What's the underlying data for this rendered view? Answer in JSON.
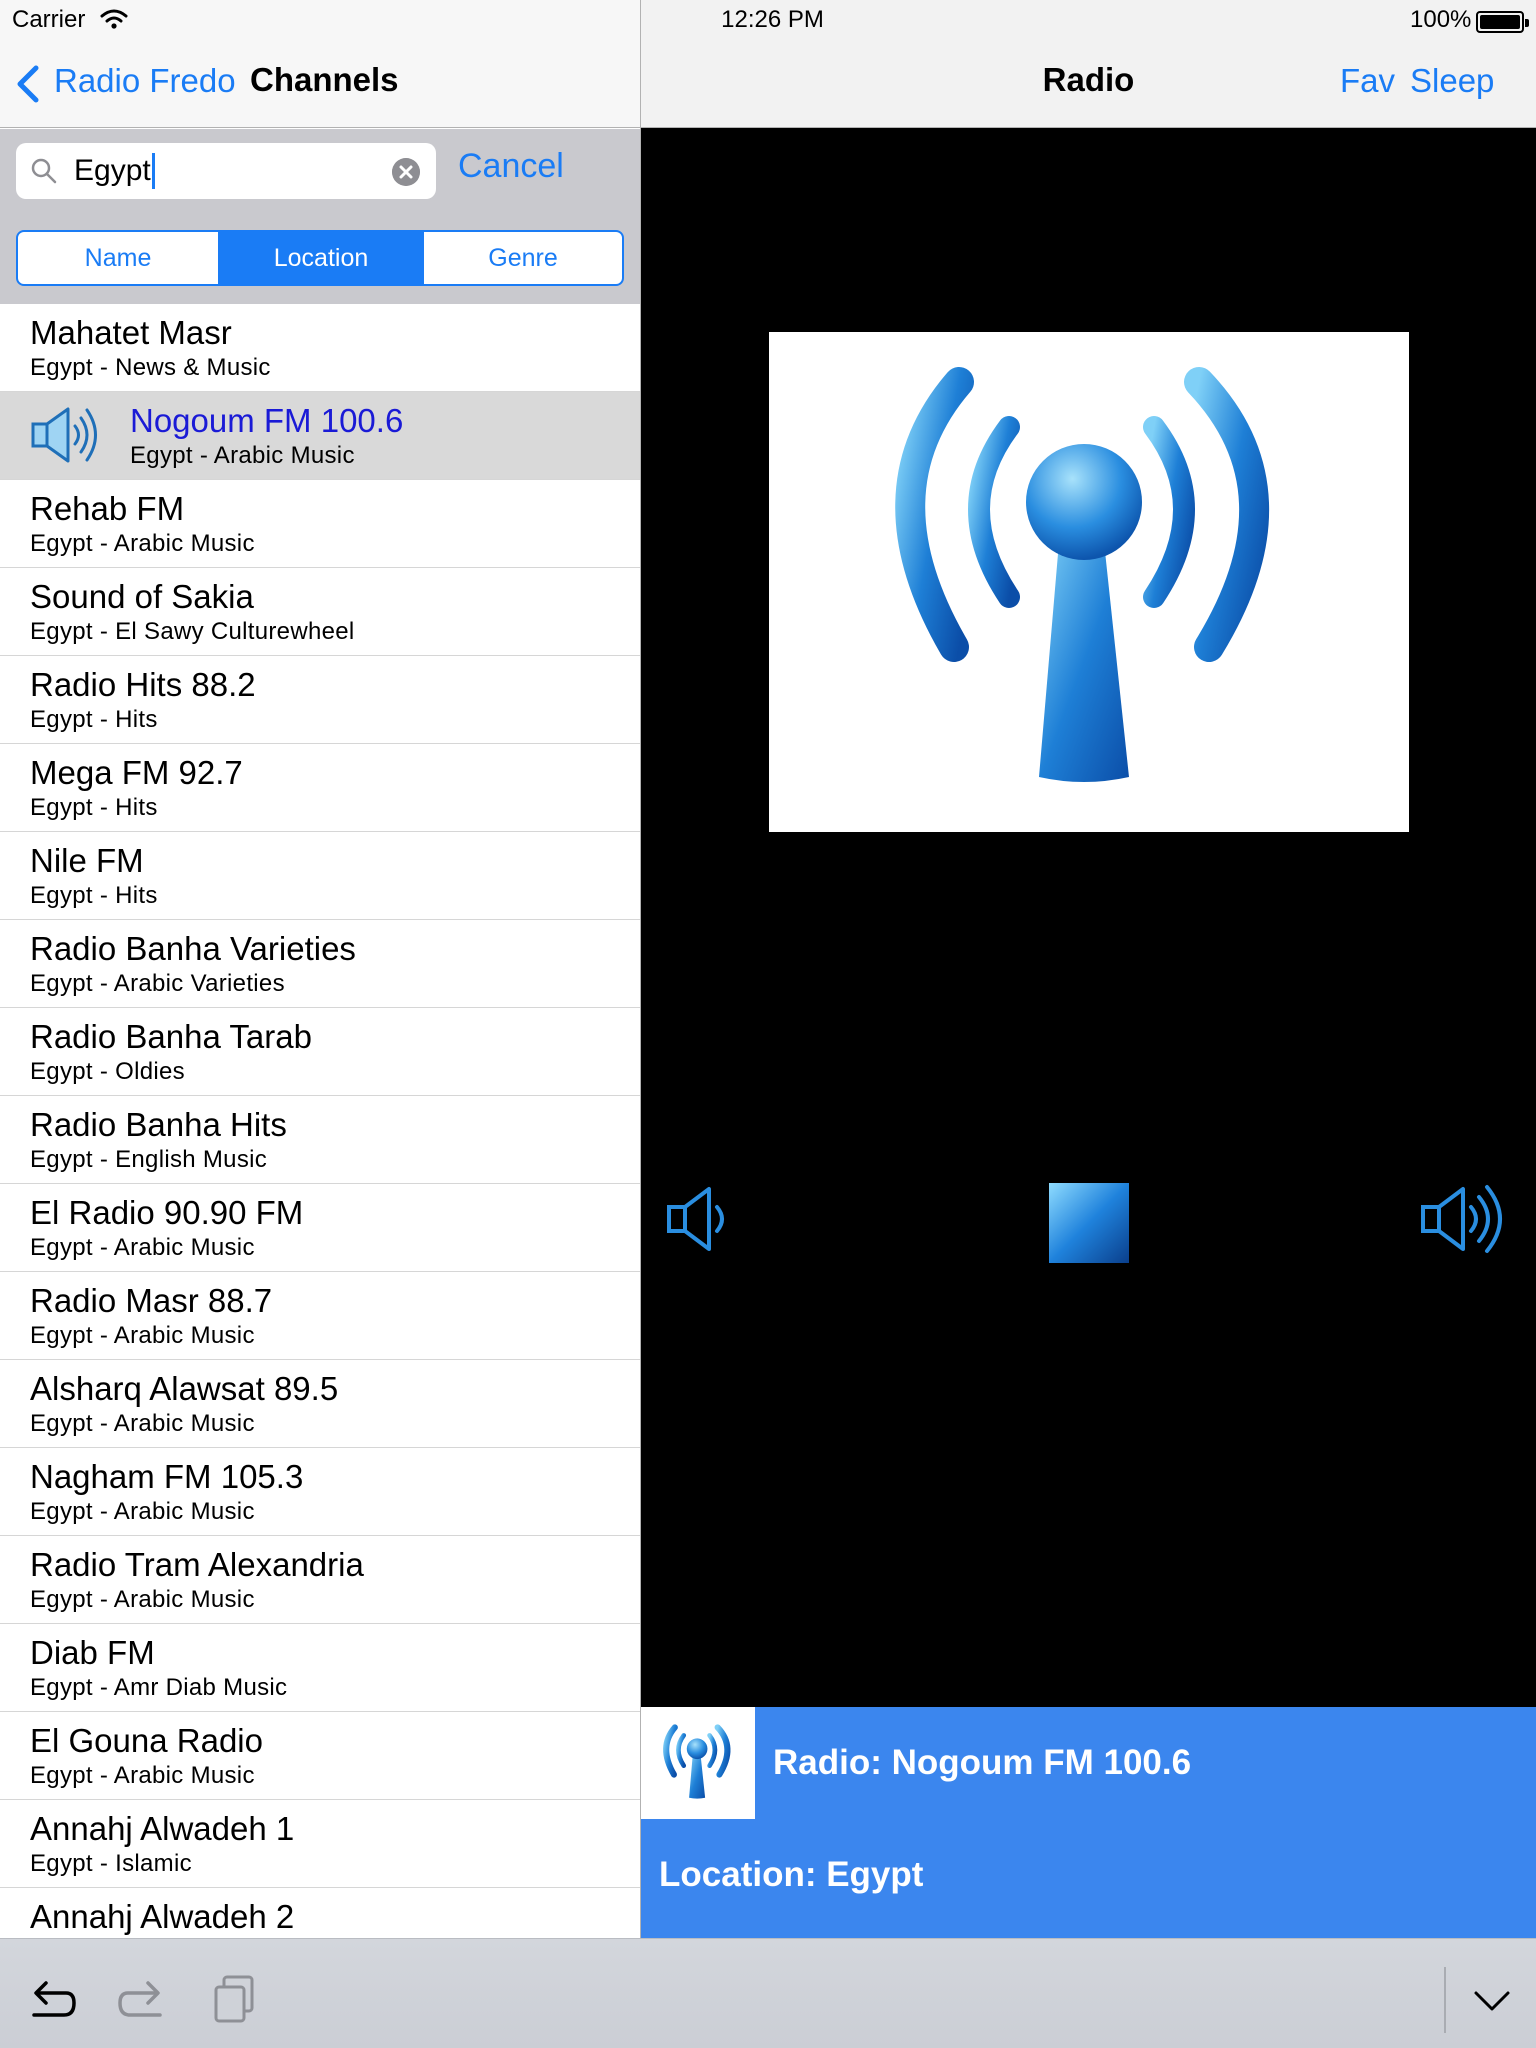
{
  "status_bar": {
    "carrier": "Carrier",
    "time": "12:26 PM",
    "battery": "100%"
  },
  "nav_left": {
    "back_label": "Radio Fredo",
    "title": "Channels"
  },
  "search": {
    "value": "Egypt",
    "cancel_label": "Cancel"
  },
  "segments": [
    {
      "label": "Name",
      "active": false
    },
    {
      "label": "Location",
      "active": true
    },
    {
      "label": "Genre",
      "active": false
    }
  ],
  "channels": [
    {
      "name": "Mahatet Masr",
      "detail": "Egypt - News & Music"
    },
    {
      "name": "Nogoum FM 100.6",
      "detail": "Egypt - Arabic Music"
    },
    {
      "name": "Rehab FM",
      "detail": "Egypt - Arabic Music"
    },
    {
      "name": "Sound of Sakia",
      "detail": "Egypt - El Sawy Culturewheel"
    },
    {
      "name": "Radio Hits 88.2",
      "detail": "Egypt - Hits"
    },
    {
      "name": "Mega FM 92.7",
      "detail": "Egypt - Hits"
    },
    {
      "name": "Nile FM",
      "detail": "Egypt - Hits"
    },
    {
      "name": "Radio Banha Varieties",
      "detail": "Egypt - Arabic Varieties"
    },
    {
      "name": "Radio Banha Tarab",
      "detail": "Egypt - Oldies"
    },
    {
      "name": "Radio Banha Hits",
      "detail": "Egypt - English Music"
    },
    {
      "name": "El Radio 90.90 FM",
      "detail": "Egypt - Arabic Music"
    },
    {
      "name": "Radio Masr 88.7",
      "detail": "Egypt - Arabic Music"
    },
    {
      "name": "Alsharq Alawsat 89.5",
      "detail": "Egypt - Arabic Music"
    },
    {
      "name": "Nagham FM 105.3",
      "detail": "Egypt - Arabic Music"
    },
    {
      "name": "Radio Tram Alexandria",
      "detail": "Egypt - Arabic Music"
    },
    {
      "name": "Diab FM",
      "detail": "Egypt - Amr Diab Music"
    },
    {
      "name": "El Gouna Radio",
      "detail": "Egypt - Arabic Music"
    },
    {
      "name": "Annahj Alwadeh 1",
      "detail": "Egypt - Islamic"
    },
    {
      "name": "Annahj Alwadeh 2",
      "detail": ""
    }
  ],
  "selected_index": 1,
  "nav_right": {
    "title": "Radio",
    "fav_label": "Fav",
    "sleep_label": "Sleep"
  },
  "now_playing": {
    "title": "Radio: Nogoum FM 100.6",
    "location": "Location: Egypt"
  },
  "colors": {
    "accent": "#1a7cf5",
    "panel": "#3b86ee",
    "selected_row": "#d9d9d9",
    "selected_text": "#1a1ad6"
  },
  "icons": {
    "back": "chevron-left-icon",
    "search": "magnifier-icon",
    "clear": "clear-circle-icon",
    "speaker": "speaker-icon",
    "artwork": "radio-tower-icon",
    "volume_down": "volume-down-icon",
    "stop": "stop-icon",
    "volume_up": "volume-up-icon",
    "undo": "undo-icon",
    "redo": "redo-icon",
    "paste": "paste-icon",
    "dismiss": "keyboard-dismiss-icon"
  }
}
